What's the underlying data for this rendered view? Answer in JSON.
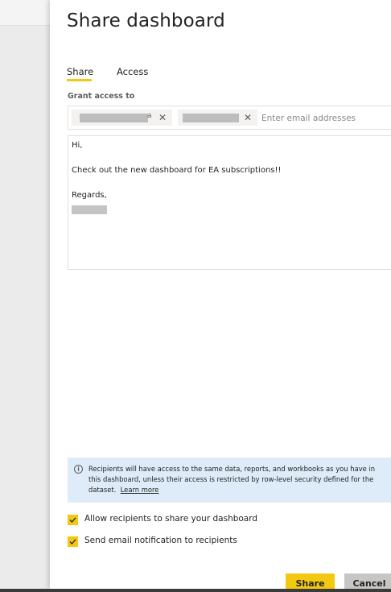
{
  "dialog": {
    "title": "Share dashboard"
  },
  "tabs": [
    {
      "label": "Share",
      "active": true
    },
    {
      "label": "Access",
      "active": false
    }
  ],
  "grant_access": {
    "label": "Grant access to",
    "recipients": [
      {
        "visible_suffix": "a",
        "redacted": true
      },
      {
        "visible_suffix": "",
        "redacted": true
      }
    ],
    "placeholder": "Enter email addresses",
    "value": ""
  },
  "message": {
    "greeting": "Hi,",
    "body": "Check out the new dashboard for EA subscriptions!!",
    "closing": "Regards,",
    "signature_redacted": true
  },
  "info": {
    "text": "Recipients will have access to the same data, reports, and workbooks as you have in this dashboard, unless their access is restricted by row-level security defined for the dataset.",
    "link": "Learn more",
    "icon": "info-icon"
  },
  "options": [
    {
      "label": "Allow recipients to share your dashboard",
      "checked": true
    },
    {
      "label": "Send email notification to recipients",
      "checked": true
    }
  ],
  "buttons": {
    "share": "Share",
    "cancel": "Cancel"
  },
  "colors": {
    "accent": "#f2c811",
    "info_background": "#deecf9",
    "cancel_background": "#c8c6c4"
  }
}
